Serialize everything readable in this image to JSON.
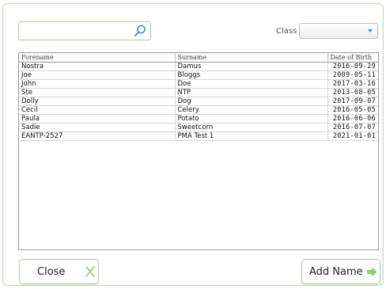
{
  "search": {
    "value": "",
    "placeholder": ""
  },
  "filter": {
    "class_label": "Class",
    "class_selected": ""
  },
  "table": {
    "headers": [
      "Forename",
      "Surname",
      "Date of Birth"
    ],
    "rows": [
      [
        "Nostra",
        "Damus",
        "2016-09-29"
      ],
      [
        "Joe",
        "Bloggs",
        "2009-05-11"
      ],
      [
        "John",
        "Doe",
        "2017-03-16"
      ],
      [
        "Ste",
        "NTP",
        "2013-08-05"
      ],
      [
        "Dolly",
        "Dog",
        "2017-09-07"
      ],
      [
        "Cecil",
        "Celery",
        "2016-05-05"
      ],
      [
        "Paula",
        "Potato",
        "2016-06-06"
      ],
      [
        "Sadie",
        "Sweetcorn",
        "2016-07-07"
      ],
      [
        "EANTP-2527",
        "PMA Test 1",
        "2021-01-01"
      ]
    ]
  },
  "buttons": {
    "close_label": "Close",
    "add_name_label": "Add Name"
  },
  "icons": {
    "search": "search-icon",
    "dropdown": "chevron-down-icon",
    "close": "close-x-icon",
    "add": "arrow-right-icon"
  },
  "colors": {
    "accent_green": "#8ccf6f",
    "border_green": "#a9cd9c",
    "dropdown_blue": "#3b86d6"
  }
}
